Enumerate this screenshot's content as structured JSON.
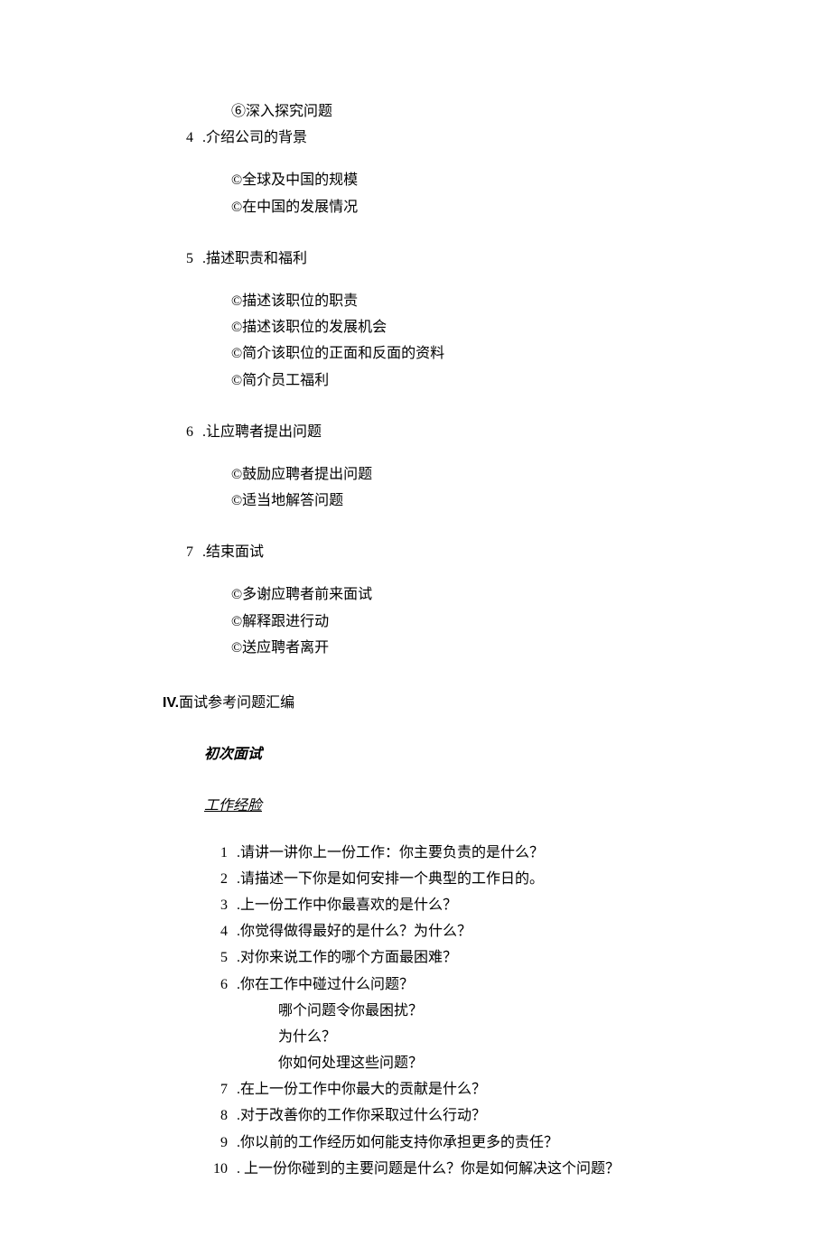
{
  "sec3_sub6": "⑥深入探究问题",
  "sec4": {
    "num": "4",
    "title": ".介绍公司的背景",
    "items": [
      "©全球及中国的规模",
      "©在中国的发展情况"
    ]
  },
  "sec5": {
    "num": "5",
    "title": ".描述职责和福利",
    "items": [
      "©描述该职位的职责",
      "©描述该职位的发展机会",
      "©简介该职位的正面和反面的资料",
      "©简介员工福利"
    ]
  },
  "sec6": {
    "num": "6",
    "title": ".让应聘者提出问题",
    "items": [
      "©鼓励应聘者提出问题",
      "©适当地解答问题"
    ]
  },
  "sec7": {
    "num": "7",
    "title": ".结束面试",
    "items": [
      "©多谢应聘者前来面试",
      "©解释跟进行动",
      "©送应聘者离开"
    ]
  },
  "section_iv": {
    "roman": "IV.",
    "title": "面试参考问题汇编"
  },
  "initial_interview": "初次面试",
  "work_exp": "工作经脸",
  "questions": [
    {
      "n": "1",
      "t": ".请讲一讲你上一份工作：你主要负责的是什么？"
    },
    {
      "n": "2",
      "t": ".请描述一下你是如何安排一个典型的工作日的。"
    },
    {
      "n": "3",
      "t": ".上一份工作中你最喜欢的是什么？"
    },
    {
      "n": "4",
      "t": ".你觉得做得最好的是什么？为什么？"
    },
    {
      "n": "5",
      "t": ".对你来说工作的哪个方面最困难？"
    },
    {
      "n": "6",
      "t": ".你在工作中碰过什么问题？"
    }
  ],
  "q6_sub": [
    "哪个问题令你最困扰？",
    "为什么？",
    "你如何处理这些问题？"
  ],
  "questions2": [
    {
      "n": "7",
      "t": ".在上一份工作中你最大的贡献是什么？"
    },
    {
      "n": "8",
      "t": ".对于改善你的工作你采取过什么行动？"
    },
    {
      "n": "9",
      "t": ".你以前的工作经历如何能支持你承担更多的责任？"
    },
    {
      "n": "10",
      "t": ". 上一份你碰到的主要问题是什么？你是如何解决这个问题？"
    }
  ]
}
